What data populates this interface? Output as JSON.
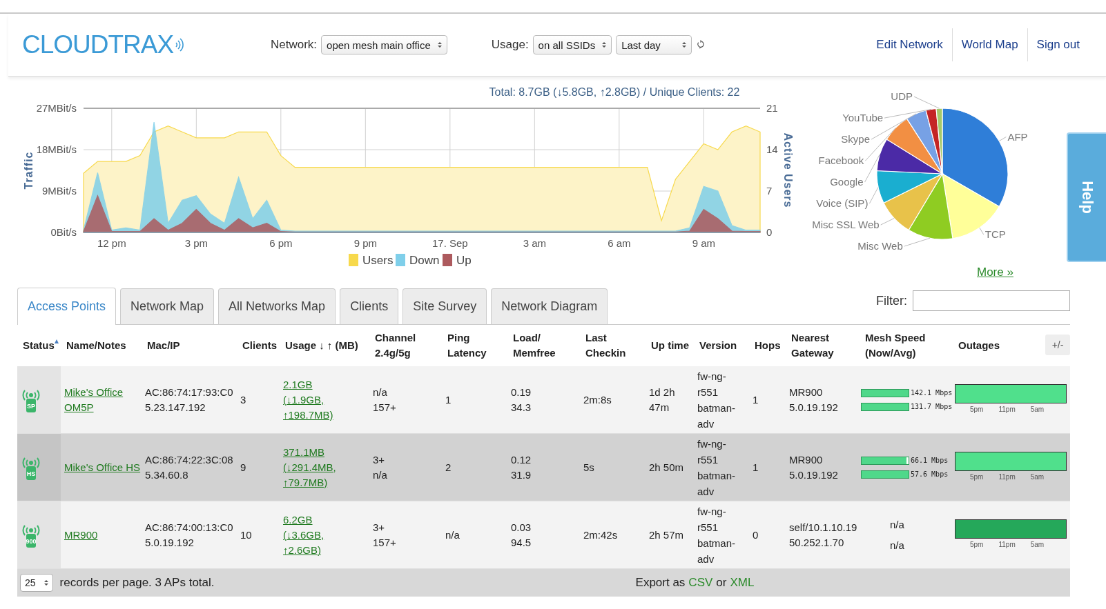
{
  "header": {
    "logo": "CLOUDTRAX",
    "network_label": "Network:",
    "network_select": "open mesh main office",
    "usage_label": "Usage:",
    "usage_select": "on all SSIDs",
    "period_select": "Last day",
    "links": [
      "Edit Network",
      "World Map",
      "Sign out"
    ]
  },
  "traffic": {
    "chart_data": {
      "type": "area",
      "title": "Total: 8.7GB (↓5.8GB, ↑2.8GB) / Unique Clients: 22",
      "ylabel": "Traffic",
      "ylim": [
        0,
        27
      ],
      "y2label": "Active Users",
      "y2lim": [
        0,
        21
      ],
      "y2ticks": [
        {
          "value": 0,
          "label": "0"
        },
        {
          "value": 7,
          "label": "7"
        },
        {
          "value": 14,
          "label": "14"
        },
        {
          "value": 21,
          "label": "21"
        }
      ],
      "grid": true,
      "legend": true,
      "categories": [
        null,
        null,
        "12 pm",
        null,
        null,
        null,
        null,
        null,
        "3 pm",
        null,
        null,
        null,
        null,
        null,
        "6 pm",
        null,
        null,
        null,
        null,
        null,
        "9 pm",
        null,
        null,
        null,
        null,
        null,
        "17. Sep",
        null,
        null,
        null,
        null,
        null,
        "3 am",
        null,
        null,
        null,
        null,
        null,
        "6 am",
        null,
        null,
        null,
        null,
        null,
        "9 am",
        null,
        null,
        null,
        null
      ],
      "yticks": [
        {
          "value": 0,
          "label": "0Bit/s"
        },
        {
          "value": 9,
          "label": "9MBit/s"
        },
        {
          "value": 18,
          "label": "18MBit/s"
        },
        {
          "value": 27,
          "label": "27MBit/s"
        }
      ],
      "stacked": false,
      "series": [
        {
          "name": "Users",
          "color": "#f7d94c",
          "axis": "y2",
          "values": [
            10,
            12,
            12,
            12,
            13,
            17,
            18,
            17,
            16,
            16,
            16,
            17,
            17,
            17,
            13,
            11,
            11,
            11,
            11,
            11,
            11,
            11,
            11,
            11,
            11,
            11,
            11,
            11,
            11,
            11,
            11,
            11,
            11,
            11,
            11,
            11,
            11,
            11,
            11,
            11,
            11,
            2,
            9,
            12,
            15,
            14,
            17,
            18,
            17
          ]
        },
        {
          "name": "Down",
          "color": "#7fcfea",
          "values": [
            0.5,
            13,
            0.5,
            1,
            0.5,
            24,
            2,
            7,
            8,
            4,
            2,
            12,
            3,
            7,
            0.5,
            0.3,
            0.3,
            0.3,
            0.3,
            0.3,
            0.3,
            0.3,
            0.3,
            0.3,
            0.3,
            0.3,
            0.3,
            0.3,
            0.3,
            0.3,
            0.3,
            0.3,
            0.3,
            0.3,
            0.3,
            0.3,
            0.3,
            0.3,
            0.3,
            0.3,
            0.3,
            0.3,
            0.3,
            1,
            10,
            9,
            1.5,
            0.5,
            0.5
          ]
        },
        {
          "name": "Up",
          "color": "#ad5a5e",
          "values": [
            0.2,
            8,
            0.2,
            0.2,
            0.2,
            3,
            0.5,
            2,
            5,
            2,
            0.5,
            3,
            1,
            2,
            0.2,
            0.1,
            0.1,
            0.1,
            0.1,
            0.1,
            0.1,
            0.1,
            0.1,
            0.1,
            0.1,
            0.1,
            0.1,
            0.1,
            0.1,
            0.1,
            0.1,
            0.1,
            0.1,
            0.1,
            0.1,
            0.1,
            0.1,
            0.1,
            0.1,
            0.1,
            0.1,
            0.1,
            0.1,
            0.3,
            5,
            3,
            0.3,
            0.2,
            0.2
          ]
        }
      ]
    }
  },
  "apps": {
    "more_link": "More »",
    "chart_data": {
      "type": "pie",
      "categories": [
        "AFP",
        "TCP",
        "Misc Web",
        "Misc SSL Web",
        "Voice (SIP)",
        "Google",
        "Facebook",
        "Skype",
        "YouTube",
        "UDP"
      ],
      "values": [
        33,
        14,
        11,
        9,
        8,
        8,
        7,
        5,
        2.5,
        1.5
      ],
      "colors": [
        "#2f7ed8",
        "#ffff99",
        "#8fcc22",
        "#e8c24a",
        "#1aaed0",
        "#4b2aa6",
        "#f28f43",
        "#77a1e5",
        "#c42525",
        "#a6c96a"
      ]
    }
  },
  "help_tab": "Help",
  "tabs": [
    {
      "label": "Access Points",
      "selected": true
    },
    {
      "label": "Network Map",
      "selected": false
    },
    {
      "label": "All Networks Map",
      "selected": false
    },
    {
      "label": "Clients",
      "selected": false
    },
    {
      "label": "Site Survey",
      "selected": false
    },
    {
      "label": "Network Diagram",
      "selected": false
    }
  ],
  "filter": {
    "label": "Filter:"
  },
  "table": {
    "columns": [
      "Status",
      "Name/Notes",
      "Mac/IP",
      "Clients",
      "Usage ↓ ↑ (MB)",
      "Channel 2.4g/5g",
      "Ping Latency",
      "Load/ Memfree",
      "Last Checkin",
      "Up time",
      "Version",
      "Hops",
      "Nearest Gateway",
      "Mesh Speed (Now/Avg)",
      "Outages"
    ],
    "toggle": "+/-",
    "rows": [
      {
        "badge": "SP",
        "name": "Mike's Office OM5P",
        "mac": "AC:86:74:17:93:C0",
        "ip": "5.23.147.192",
        "clients": "3",
        "usage_total": "2.1GB",
        "usage_detail": "(↓1.9GB, ↑198.7MB)",
        "channel": [
          "n/a",
          "157+"
        ],
        "ping": "1",
        "load": [
          "0.19",
          "34.3"
        ],
        "checkin": "2m:8s",
        "uptime": "1d 2h 47m",
        "version": "fw-ng-r551 batman-adv",
        "hops": "1",
        "gateway": [
          "MR900",
          "5.0.19.192"
        ],
        "mesh": [
          {
            "kind": "bar",
            "level": 1,
            "reading": "142.1 Mbps"
          },
          {
            "kind": "bar",
            "level": 1,
            "reading": "131.7 Mbps"
          }
        ],
        "outages": {
          "color": "#50e08c",
          "labels": [
            "5pm",
            "11pm",
            "5am"
          ]
        }
      },
      {
        "badge": "HS",
        "name": "Mike's Office HS",
        "mac": "AC:86:74:22:3C:08",
        "ip": "5.34.60.8",
        "clients": "9",
        "usage_total": "371.1MB",
        "usage_detail": "(↓291.4MB, ↑79.7MB)",
        "channel": [
          "3+",
          "n/a"
        ],
        "ping": "2",
        "load": [
          "0.12",
          "31.9"
        ],
        "checkin": "5s",
        "uptime": "2h 50m",
        "version": "fw-ng-r551 batman-adv",
        "hops": "1",
        "gateway": [
          "MR900",
          "5.0.19.192"
        ],
        "mesh": [
          {
            "kind": "bar",
            "level": 0.95,
            "reading": "66.1 Mbps"
          },
          {
            "kind": "bar",
            "level": 1,
            "reading": "57.6 Mbps"
          }
        ],
        "outages": {
          "color": "#50e08c",
          "labels": [
            "5pm",
            "11pm",
            "5am"
          ]
        }
      },
      {
        "badge": "900",
        "name": "MR900",
        "mac": "AC:86:74:00:13:C0",
        "ip": "5.0.19.192",
        "clients": "10",
        "usage_total": "6.2GB",
        "usage_detail": "(↓3.6GB, ↑2.6GB)",
        "channel": [
          "3+",
          "157+"
        ],
        "ping": "n/a",
        "load": [
          "0.03",
          "94.5"
        ],
        "checkin": "2m:42s",
        "uptime": "2h 57m",
        "version": "fw-ng-r551 batman-adv",
        "hops": "0",
        "gateway": [
          "self/10.1.10.19",
          "50.252.1.70"
        ],
        "mesh": [
          {
            "kind": "text",
            "text": "n/a"
          },
          {
            "kind": "text",
            "text": "n/a"
          }
        ],
        "outages": {
          "color": "#25a85a",
          "labels": [
            "5pm",
            "11pm",
            "5am"
          ]
        }
      }
    ]
  },
  "footer": {
    "per_page": "25",
    "records_text": "records per page. 3 APs total.",
    "export_text": "Export as",
    "csv": "CSV",
    "or": "or",
    "xml": "XML"
  }
}
